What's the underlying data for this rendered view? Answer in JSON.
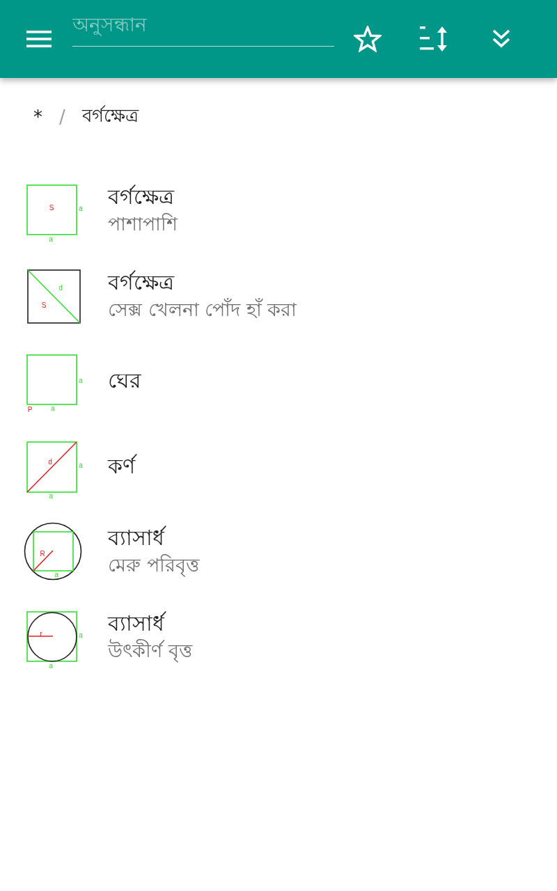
{
  "toolbar": {
    "search": {
      "placeholder": "অনুসন্ধান"
    }
  },
  "breadcrumb": {
    "items": [
      {
        "label": "*"
      },
      {
        "label": "বর্গক্ষেত্র"
      }
    ],
    "separator": "/"
  },
  "items": [
    {
      "title": "বর্গক্ষেত্র",
      "subtitle": "পাশাপাশি",
      "figure": {
        "kind": "area",
        "labels": [
          "S",
          "a",
          "a"
        ]
      }
    },
    {
      "title": "বর্গক্ষেত্র",
      "subtitle": "সেক্স খেলনা পোঁদ হাঁ করা",
      "figure": {
        "kind": "diagonal-area",
        "labels": [
          "d",
          "S"
        ]
      }
    },
    {
      "title": "ঘের",
      "figure": {
        "kind": "perimeter",
        "labels": [
          "a",
          "P",
          "a"
        ]
      }
    },
    {
      "title": "কর্ণ",
      "figure": {
        "kind": "diagonal",
        "labels": [
          "d",
          "a",
          "a"
        ]
      }
    },
    {
      "title": "ব্যাসার্ধ",
      "subtitle": "মেরু পরিবৃত্ত",
      "figure": {
        "kind": "circumscribed",
        "labels": [
          "R",
          "a"
        ]
      }
    },
    {
      "title": "ব্যাসার্ধ",
      "subtitle": "উৎকীর্ণ বৃত্ত",
      "figure": {
        "kind": "inscribed",
        "labels": [
          "r",
          "a",
          "a"
        ]
      }
    }
  ]
}
